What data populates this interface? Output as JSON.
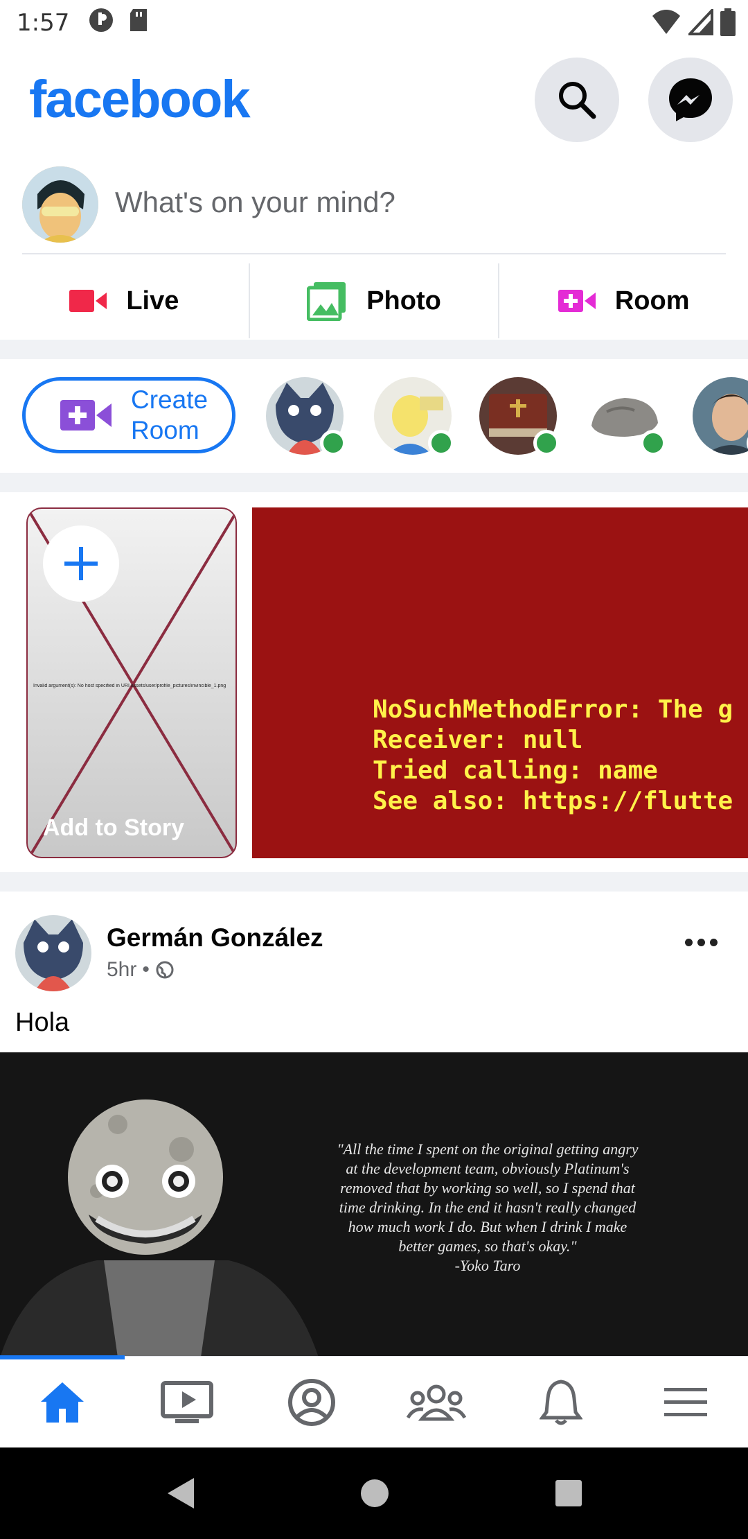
{
  "status_bar": {
    "time": "1:57"
  },
  "header": {
    "logo": "facebook",
    "search_icon": "search-icon",
    "messenger_icon": "messenger-icon"
  },
  "composer": {
    "placeholder": "What's on your mind?",
    "actions": [
      {
        "label": "Live",
        "icon": "live-video-icon",
        "color": "#f02849"
      },
      {
        "label": "Photo",
        "icon": "photo-icon",
        "color": "#45bd62"
      },
      {
        "label": "Room",
        "icon": "room-icon",
        "color": "#e42bd5"
      }
    ]
  },
  "rooms": {
    "create_label": "Create Room",
    "create_label_line1": "Create",
    "create_label_line2": "Room"
  },
  "stories": {
    "add_label": "Add to Story",
    "broken_image_text": "Invalid argument(s): No host specified in URI assets/user/profile_pictures/invincible_1.png",
    "error_lines": [
      "NoSuchMethodError: The g",
      "Receiver: null",
      "Tried calling: name",
      "See also: https://flutte"
    ]
  },
  "post": {
    "author": "Germán González",
    "time": "5hr",
    "text": "Hola",
    "quote_lines": [
      "\"All the time I spent on the original getting angry",
      "at the development team, obviously Platinum's",
      "removed that by working so well, so I spend that",
      "time drinking. In the end it hasn't really changed",
      "how much work I do. But when I drink I make",
      "better games, so that's okay.\"",
      "-Yoko Taro"
    ]
  },
  "bottom_nav": {
    "active_index": 0,
    "items": [
      "home-icon",
      "watch-icon",
      "profile-icon",
      "groups-icon",
      "notifications-icon",
      "menu-icon"
    ]
  },
  "colors": {
    "brand": "#1877f2",
    "online": "#31a24c",
    "error_bg": "#9b1212",
    "error_text": "#fff24a"
  }
}
